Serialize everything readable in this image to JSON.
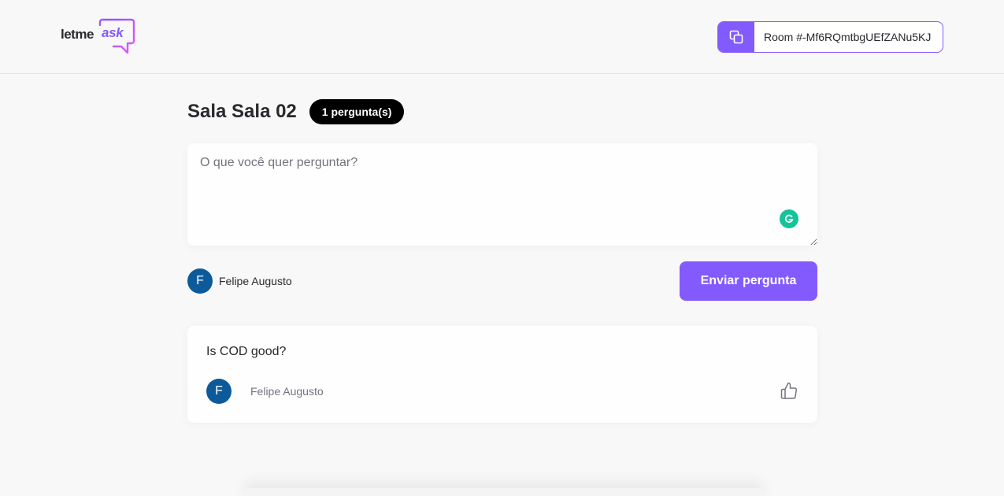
{
  "header": {
    "logo": {
      "part1": "letme",
      "part2": "ask"
    },
    "room_code": "Room #-Mf6RQmtbgUEfZANu5KJ"
  },
  "room": {
    "title": "Sala Sala 02",
    "question_count": "1 pergunta(s)"
  },
  "form": {
    "placeholder": "O que você quer perguntar?",
    "value": "",
    "user": {
      "avatar_letter": "F",
      "name": "Felipe Augusto"
    },
    "submit_label": "Enviar pergunta"
  },
  "questions": [
    {
      "content": "Is COD good?",
      "author": {
        "avatar_letter": "F",
        "name": "Felipe Augusto"
      },
      "like_icon": "thumbs-up-icon"
    }
  ],
  "colors": {
    "accent": "#835afd",
    "avatar": "#0d5a9a",
    "badge": "#000000",
    "grammarly": "#15c39a"
  }
}
